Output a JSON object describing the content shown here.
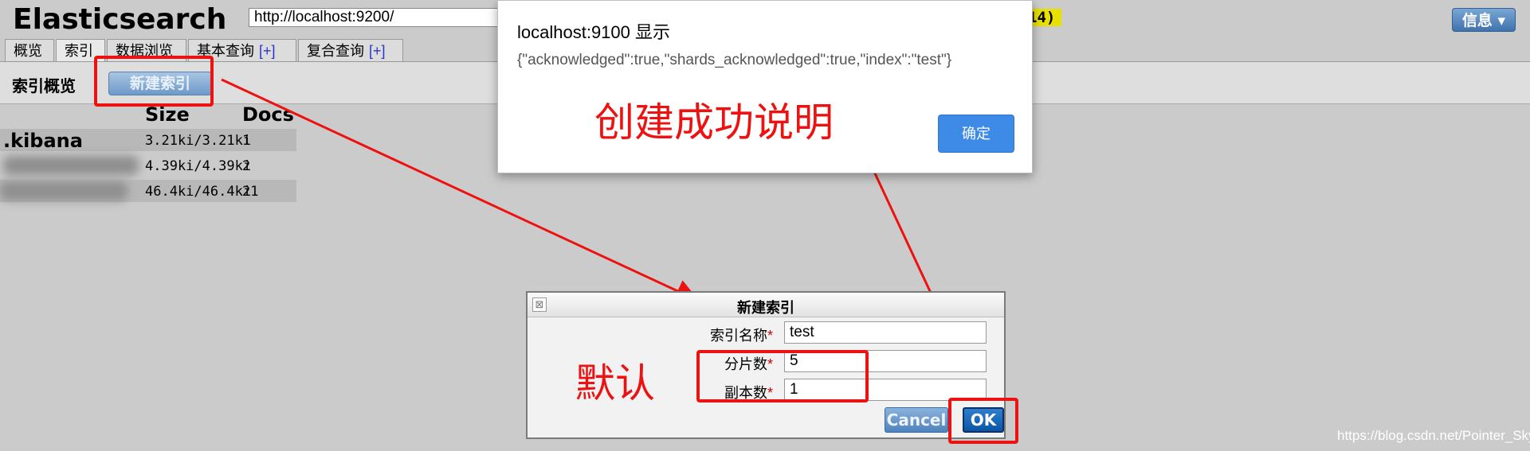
{
  "header": {
    "app_title": "Elasticsearch",
    "url": "http://localhost:9200/",
    "cluster_status": "14)",
    "info_button": "信息 ▾"
  },
  "tabs": [
    {
      "label": "概览",
      "plus": ""
    },
    {
      "label": "索引",
      "plus": ""
    },
    {
      "label": "数据浏览",
      "plus": ""
    },
    {
      "label": "基本查询",
      "plus": "[+]"
    },
    {
      "label": "复合查询",
      "plus": "[+]"
    }
  ],
  "toolbar": {
    "title": "索引概览",
    "new_index_button": "新建索引"
  },
  "index_table": {
    "headers": {
      "size": "Size",
      "docs": "Docs"
    },
    "rows": [
      {
        "name": ".kibana",
        "size": "3.21ki/3.21ki",
        "docs": "1"
      },
      {
        "name": "",
        "size": "4.39ki/4.39ki",
        "docs": "2"
      },
      {
        "name": "",
        "size": "46.4ki/46.4ki",
        "docs": "21"
      }
    ]
  },
  "alert": {
    "title": "localhost:9100 显示",
    "message": "{\"acknowledged\":true,\"shards_acknowledged\":true,\"index\":\"test\"}",
    "confirm_label": "确定"
  },
  "new_index_dialog": {
    "title": "新建索引",
    "close_icon": "⊠",
    "fields": [
      {
        "label": "索引名称",
        "required_mark": "*",
        "value": "test"
      },
      {
        "label": "分片数",
        "required_mark": "*",
        "value": "5"
      },
      {
        "label": "副本数",
        "required_mark": "*",
        "value": "1"
      }
    ],
    "cancel_label": "Cancel",
    "ok_label": "OK"
  },
  "annotations": {
    "success_note": "创建成功说明",
    "default_note": "默认",
    "color": "#ee1111"
  },
  "watermark": "https://blog.csdn.net/Pointer_Sky"
}
